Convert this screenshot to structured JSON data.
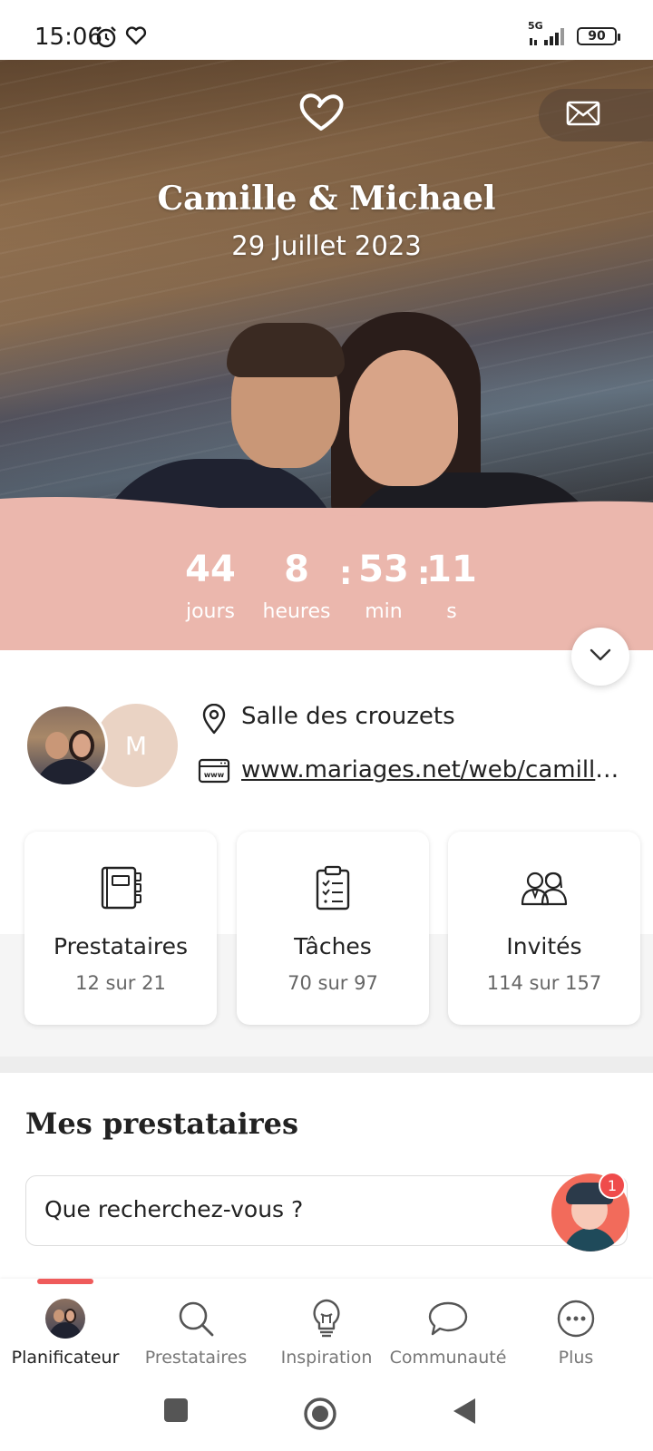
{
  "status_bar": {
    "time": "15:06",
    "network": "5G",
    "battery": "90"
  },
  "hero": {
    "couple_names": "Camille & Michael",
    "date": "29 Juillet 2023"
  },
  "countdown": {
    "days_value": "44",
    "days_label": "jours",
    "hours_value": "8",
    "hours_label": "heures",
    "minutes_value": "53",
    "minutes_label": "min",
    "seconds_value": "11",
    "seconds_label": "s"
  },
  "info": {
    "avatar_initial": "M",
    "venue": "Salle des crouzets",
    "website": "www.mariages.net/web/camille-..."
  },
  "cards": [
    {
      "title": "Prestataires",
      "count": "12 sur 21"
    },
    {
      "title": "Tâches",
      "count": "70 sur 97"
    },
    {
      "title": "Invités",
      "count": "114 sur 157"
    }
  ],
  "section": {
    "title": "Mes prestataires",
    "search_placeholder": "Que recherchez-vous ?",
    "assistant_badge": "1"
  },
  "bottom_nav": [
    {
      "label": "Planificateur",
      "active": true
    },
    {
      "label": "Prestataires"
    },
    {
      "label": "Inspiration"
    },
    {
      "label": "Communauté"
    },
    {
      "label": "Plus"
    }
  ],
  "colors": {
    "countdown_bg": "#ebb7ad",
    "accent": "#ef5b5b"
  }
}
